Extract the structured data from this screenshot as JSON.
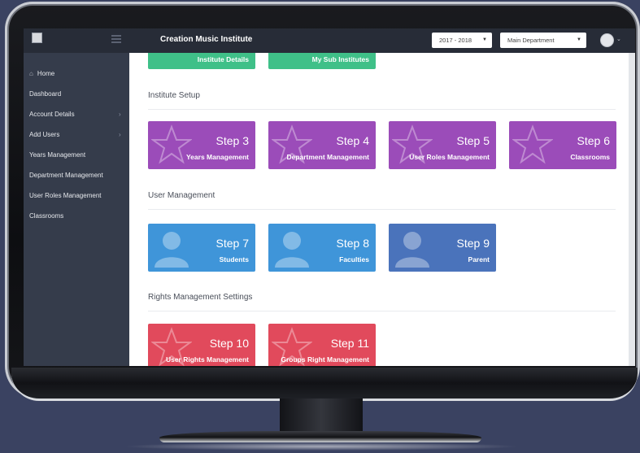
{
  "header": {
    "app_title": "Creation Music Institute",
    "year_select": "2017 - 2018",
    "department_select": "Main Department"
  },
  "sidebar": {
    "items": [
      {
        "label": "Home"
      },
      {
        "label": "Dashboard"
      },
      {
        "label": "Account Details"
      },
      {
        "label": "Add Users"
      },
      {
        "label": "Years Management"
      },
      {
        "label": "Department Management"
      },
      {
        "label": "User Roles Management"
      },
      {
        "label": "Classrooms"
      }
    ]
  },
  "main": {
    "top_cards": [
      {
        "label": "Institute Details"
      },
      {
        "label": "My Sub Institutes"
      }
    ],
    "sections": [
      {
        "title": "Institute Setup",
        "cards": [
          {
            "step": "Step 3",
            "label": "Years Management"
          },
          {
            "step": "Step 4",
            "label": "Department Management"
          },
          {
            "step": "Step 5",
            "label": "User Roles Management"
          },
          {
            "step": "Step 6",
            "label": "Classrooms"
          }
        ]
      },
      {
        "title": "User Management",
        "cards": [
          {
            "step": "Step 7",
            "label": "Students"
          },
          {
            "step": "Step 8",
            "label": "Faculties"
          },
          {
            "step": "Step 9",
            "label": "Parent"
          }
        ]
      },
      {
        "title": "Rights Management Settings",
        "cards": [
          {
            "step": "Step 10",
            "label": "User Rights Management"
          },
          {
            "step": "Step 11",
            "label": "Groups Right Management"
          }
        ]
      }
    ]
  },
  "colors": {
    "purple": "#9b4cb9",
    "blue": "#3f95d9",
    "blue_dark": "#4a73bb",
    "red": "#e14a5c",
    "green": "#3fc088",
    "topbar": "#272c37",
    "sidebar": "#353c4b"
  }
}
